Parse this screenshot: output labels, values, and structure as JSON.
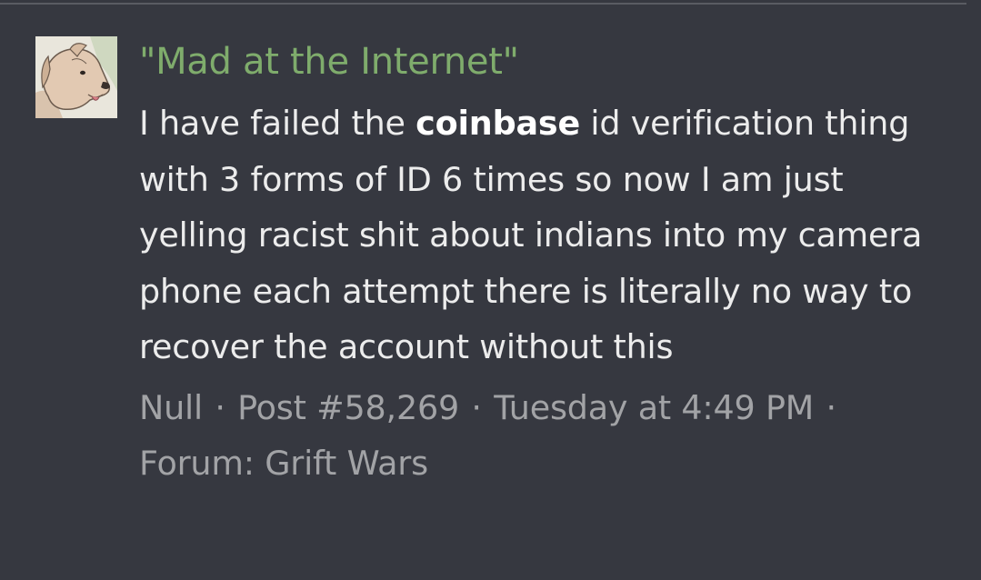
{
  "result": {
    "thread_title": "\"Mad at the Internet\"",
    "snippet": {
      "before": "I have failed the ",
      "highlight": "coinbase",
      "after": " id verification thing with 3 forms of ID 6 times so now I am just yelling racist shit about indians into my camera phone each attempt there is literally no way to recover the account without this"
    },
    "meta": {
      "author": "Null",
      "separator": "·",
      "post_number": "Post #58,269",
      "timestamp": "Tuesday at 4:49 PM",
      "forum": "Forum: Grift Wars"
    }
  },
  "avatar": {
    "icon": "dog-avatar-icon",
    "background": "#e9e6dc"
  },
  "colors": {
    "background": "#363840",
    "title": "#7fac6c",
    "body": "#ececec",
    "meta": "#a2a3a6"
  }
}
